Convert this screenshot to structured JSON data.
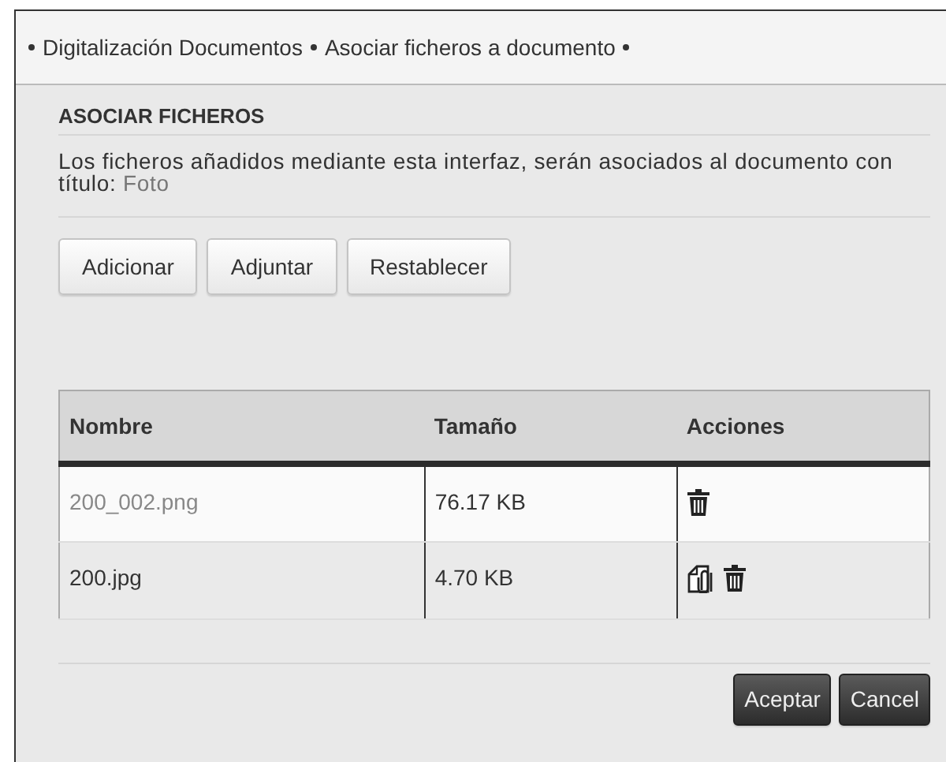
{
  "breadcrumb": [
    "Digitalización Documentos",
    "Asociar ficheros a documento"
  ],
  "section_title": "ASOCIAR FICHEROS",
  "description": {
    "text": "Los ficheros añadidos mediante esta interfaz, serán asociados al documento con título:",
    "title_value": "Foto"
  },
  "toolbar_buttons": [
    "Adicionar",
    "Adjuntar",
    "Restablecer"
  ],
  "table": {
    "columns": [
      "Nombre",
      "Tamaño",
      "Acciones"
    ],
    "rows": [
      {
        "name": "200_002.png",
        "size": "76.17 KB",
        "dimmed": true,
        "actions": [
          {
            "kind": "delete"
          }
        ]
      },
      {
        "name": "200.jpg",
        "size": "4.70 KB",
        "dimmed": false,
        "actions": [
          {
            "kind": "attach"
          },
          {
            "kind": "delete"
          }
        ]
      }
    ]
  },
  "footer_buttons": [
    "Aceptar",
    "Cancel"
  ]
}
